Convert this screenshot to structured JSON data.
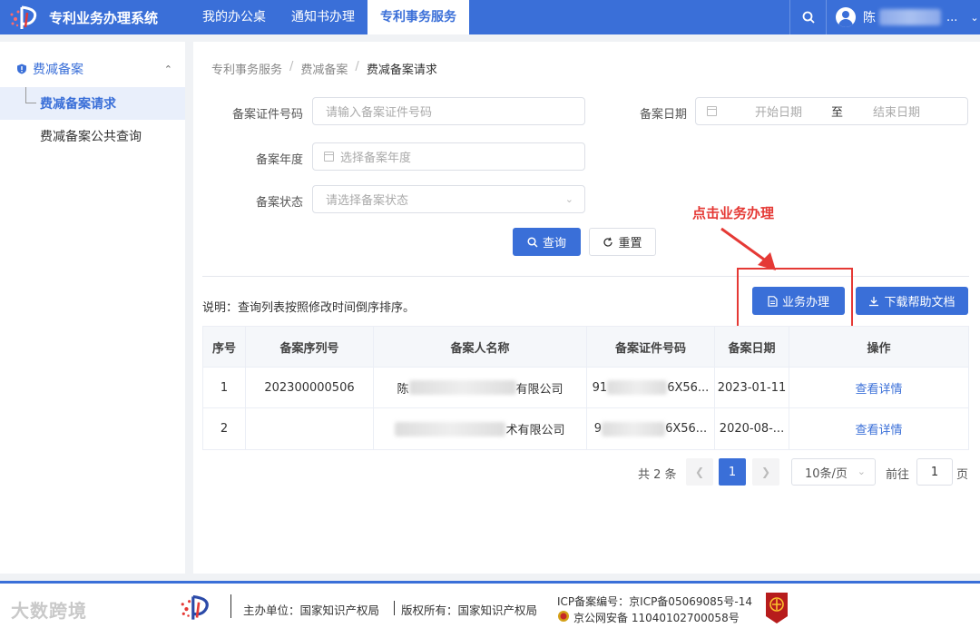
{
  "header": {
    "app_title": "专利业务办理系统",
    "nav": [
      {
        "label": "我的办公桌"
      },
      {
        "label": "通知书办理"
      },
      {
        "label": "专利事务服务"
      }
    ],
    "user_initial": "陈",
    "user_suffix": "..."
  },
  "sidebar": {
    "group_label": "费减备案",
    "items": [
      {
        "label": "费减备案请求"
      },
      {
        "label": "费减备案公共查询"
      }
    ]
  },
  "breadcrumb": {
    "items": [
      "专利事务服务",
      "费减备案",
      "费减备案请求"
    ],
    "separator": "/"
  },
  "form": {
    "cert_no_label": "备案证件号码",
    "cert_no_placeholder": "请输入备案证件号码",
    "date_label": "备案日期",
    "date_start_placeholder": "开始日期",
    "date_to": "至",
    "date_end_placeholder": "结束日期",
    "year_label": "备案年度",
    "year_placeholder": "选择备案年度",
    "status_label": "备案状态",
    "status_placeholder": "请选择备案状态",
    "query_button": "查询",
    "reset_button": "重置"
  },
  "annotation": {
    "text": "点击业务办理"
  },
  "toolbar": {
    "note": "说明：查询列表按照修改时间倒序排序。",
    "handle_button": "业务办理",
    "download_button": "下载帮助文档"
  },
  "table": {
    "columns": [
      "序号",
      "备案序列号",
      "备案人名称",
      "备案证件号码",
      "备案日期",
      "操作"
    ],
    "rows": [
      {
        "index": "1",
        "serial": "202300000506",
        "name_prefix": "陈",
        "name_suffix": "有限公司",
        "cert_prefix": "91",
        "cert_suffix": "6X56...",
        "date": "2023-01-11",
        "action": "查看详情"
      },
      {
        "index": "2",
        "serial": "",
        "name_prefix": "",
        "name_suffix": "术有限公司",
        "cert_prefix": "9",
        "cert_suffix": "6X56...",
        "date": "2020-08-...",
        "action": "查看详情"
      }
    ]
  },
  "pagination": {
    "total_text": "共 2 条",
    "current_page": "1",
    "page_size": "10条/页",
    "goto_prefix": "前往",
    "goto_value": "1",
    "goto_suffix": "页"
  },
  "footer": {
    "watermark": "大数跨境",
    "sponsor": "主办单位：国家知识产权局",
    "copyright": "版权所有：国家知识产权局",
    "icp": "ICP备案编号：京ICP备05069085号-14",
    "police": "京公网安备 11040102700058号"
  },
  "colors": {
    "primary": "#3a6fd8",
    "annotation": "#e53935"
  }
}
